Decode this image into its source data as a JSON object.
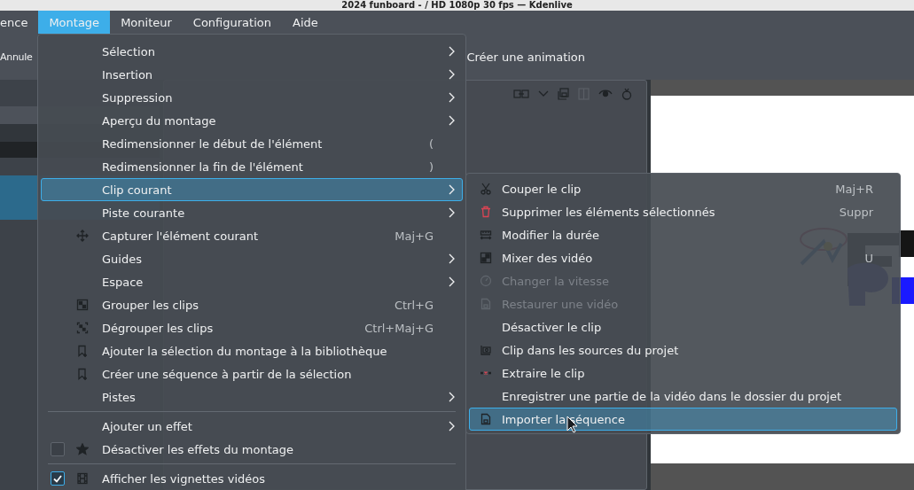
{
  "window": {
    "title": "2024 funboard - / HD 1080p 30 fps — Kdenlive"
  },
  "menubar": [
    {
      "label": "ence",
      "selected": false
    },
    {
      "label": "Montage",
      "selected": true
    },
    {
      "label": "Moniteur",
      "selected": false
    },
    {
      "label": "Configuration",
      "selected": false
    },
    {
      "label": "Aide",
      "selected": false
    }
  ],
  "toolbar": [
    {
      "label": "Annule"
    },
    {
      "label": "Créer une animation"
    }
  ],
  "montage_menu": {
    "items": [
      {
        "kind": "item",
        "label": "Sélection",
        "submenu": true,
        "selected": false
      },
      {
        "kind": "item",
        "label": "Insertion",
        "submenu": true,
        "selected": false
      },
      {
        "kind": "item",
        "label": "Suppression",
        "submenu": true,
        "selected": false
      },
      {
        "kind": "item",
        "label": "Aperçu du montage",
        "submenu": true,
        "selected": false
      },
      {
        "kind": "item",
        "label": "Redimensionner le début de l'élément",
        "shortcut": "(",
        "submenu": false,
        "selected": false
      },
      {
        "kind": "item",
        "label": "Redimensionner la fin de l'élément",
        "shortcut": ")",
        "submenu": false,
        "selected": false
      },
      {
        "kind": "item",
        "label": "Clip courant",
        "submenu": true,
        "selected": true
      },
      {
        "kind": "item",
        "label": "Piste courante",
        "submenu": true,
        "selected": false
      },
      {
        "kind": "item",
        "label": "Capturer l'élément courant",
        "shortcut": "Maj+G",
        "submenu": false,
        "selected": false
      },
      {
        "kind": "item",
        "label": "Guides",
        "submenu": true,
        "selected": false
      },
      {
        "kind": "item",
        "label": "Espace",
        "submenu": true,
        "selected": false
      },
      {
        "kind": "item",
        "label": "Grouper les clips",
        "shortcut": "Ctrl+G",
        "submenu": false,
        "selected": false
      },
      {
        "kind": "item",
        "label": "Dégrouper les clips",
        "shortcut": "Ctrl+Maj+G",
        "submenu": false,
        "selected": false
      },
      {
        "kind": "item",
        "label": "Ajouter la sélection du montage à la bibliothèque",
        "submenu": false,
        "selected": false
      },
      {
        "kind": "item",
        "label": "Créer une séquence à partir de la sélection",
        "submenu": false,
        "selected": false
      },
      {
        "kind": "item",
        "label": "Pistes",
        "submenu": true,
        "selected": false
      },
      {
        "kind": "separator"
      },
      {
        "kind": "item",
        "label": "Ajouter un effet",
        "submenu": true,
        "selected": false
      },
      {
        "kind": "check",
        "label": "Désactiver les effets du montage",
        "checked": false,
        "selected": false
      },
      {
        "kind": "separator"
      },
      {
        "kind": "check",
        "label": "Afficher les vignettes vidéos",
        "checked": true,
        "selected": false
      }
    ]
  },
  "clip_menu": {
    "items": [
      {
        "label": "Couper le clip",
        "shortcut": "Maj+R",
        "disabled": false,
        "selected": false
      },
      {
        "label": "Supprimer les éléments sélectionnés",
        "shortcut": "Suppr",
        "disabled": false,
        "selected": false
      },
      {
        "label": "Modifier la durée",
        "disabled": false,
        "selected": false
      },
      {
        "label": "Mixer des vidéo",
        "shortcut": "U",
        "disabled": false,
        "selected": false
      },
      {
        "label": "Changer la vitesse",
        "disabled": true,
        "selected": false
      },
      {
        "label": "Restaurer une vidéo",
        "disabled": true,
        "selected": false
      },
      {
        "label": "Désactiver le clip",
        "disabled": false,
        "selected": false
      },
      {
        "label": "Clip dans les sources du projet",
        "disabled": false,
        "selected": false
      },
      {
        "label": "Extraire le clip",
        "disabled": false,
        "selected": false
      },
      {
        "label": "Enregistrer une partie de la vidéo dans le dossier du projet",
        "disabled": false,
        "selected": false
      },
      {
        "label": "Importer la séquence",
        "disabled": false,
        "selected": true
      }
    ]
  }
}
